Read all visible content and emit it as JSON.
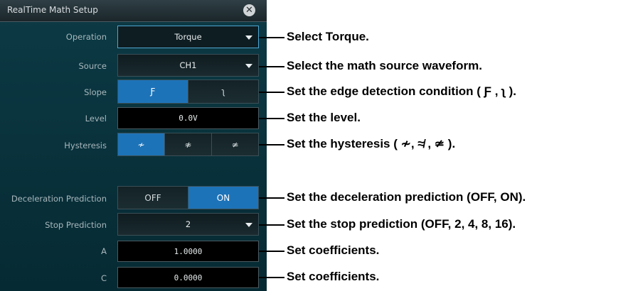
{
  "dialog": {
    "title": "RealTime Math Setup",
    "close_glyph": "✕"
  },
  "operation": {
    "label": "Operation",
    "value": "Torque"
  },
  "source": {
    "label": "Source",
    "value": "CH1"
  },
  "slope": {
    "label": "Slope",
    "options": [
      "Ƒ",
      "ʅ"
    ],
    "selected_index": 0
  },
  "level": {
    "label": "Level",
    "value": "0.0V"
  },
  "hysteresis": {
    "label": "Hysteresis",
    "options": [
      "≁",
      "≉",
      "≄"
    ],
    "selected_index": 0
  },
  "deceleration": {
    "label": "Deceleration Prediction",
    "options": [
      "OFF",
      "ON"
    ],
    "selected_index": 1
  },
  "stop_prediction": {
    "label": "Stop Prediction",
    "value": "2"
  },
  "coef_a": {
    "label": "A",
    "value": "1.0000"
  },
  "coef_c": {
    "label": "C",
    "value": "0.0000"
  },
  "annotations": {
    "operation": "Select Torque.",
    "source": "Select the math source waveform.",
    "slope": "Set the edge detection condition ( Ƒ , ʅ ).",
    "level": "Set the level.",
    "hysteresis": "Set the hysteresis ( ≁, ≉ , ≄ ).",
    "deceleration": "Set the deceleration prediction (OFF, ON).",
    "stop": "Set the stop prediction (OFF, 2, 4, 8, 16).",
    "coef_a": "Set coefficients.",
    "coef_c": "Set coefficients."
  },
  "colors": {
    "panel_bg": "#0a3540",
    "selected": "#1d73b8",
    "focus_border": "#4fa6d2"
  }
}
